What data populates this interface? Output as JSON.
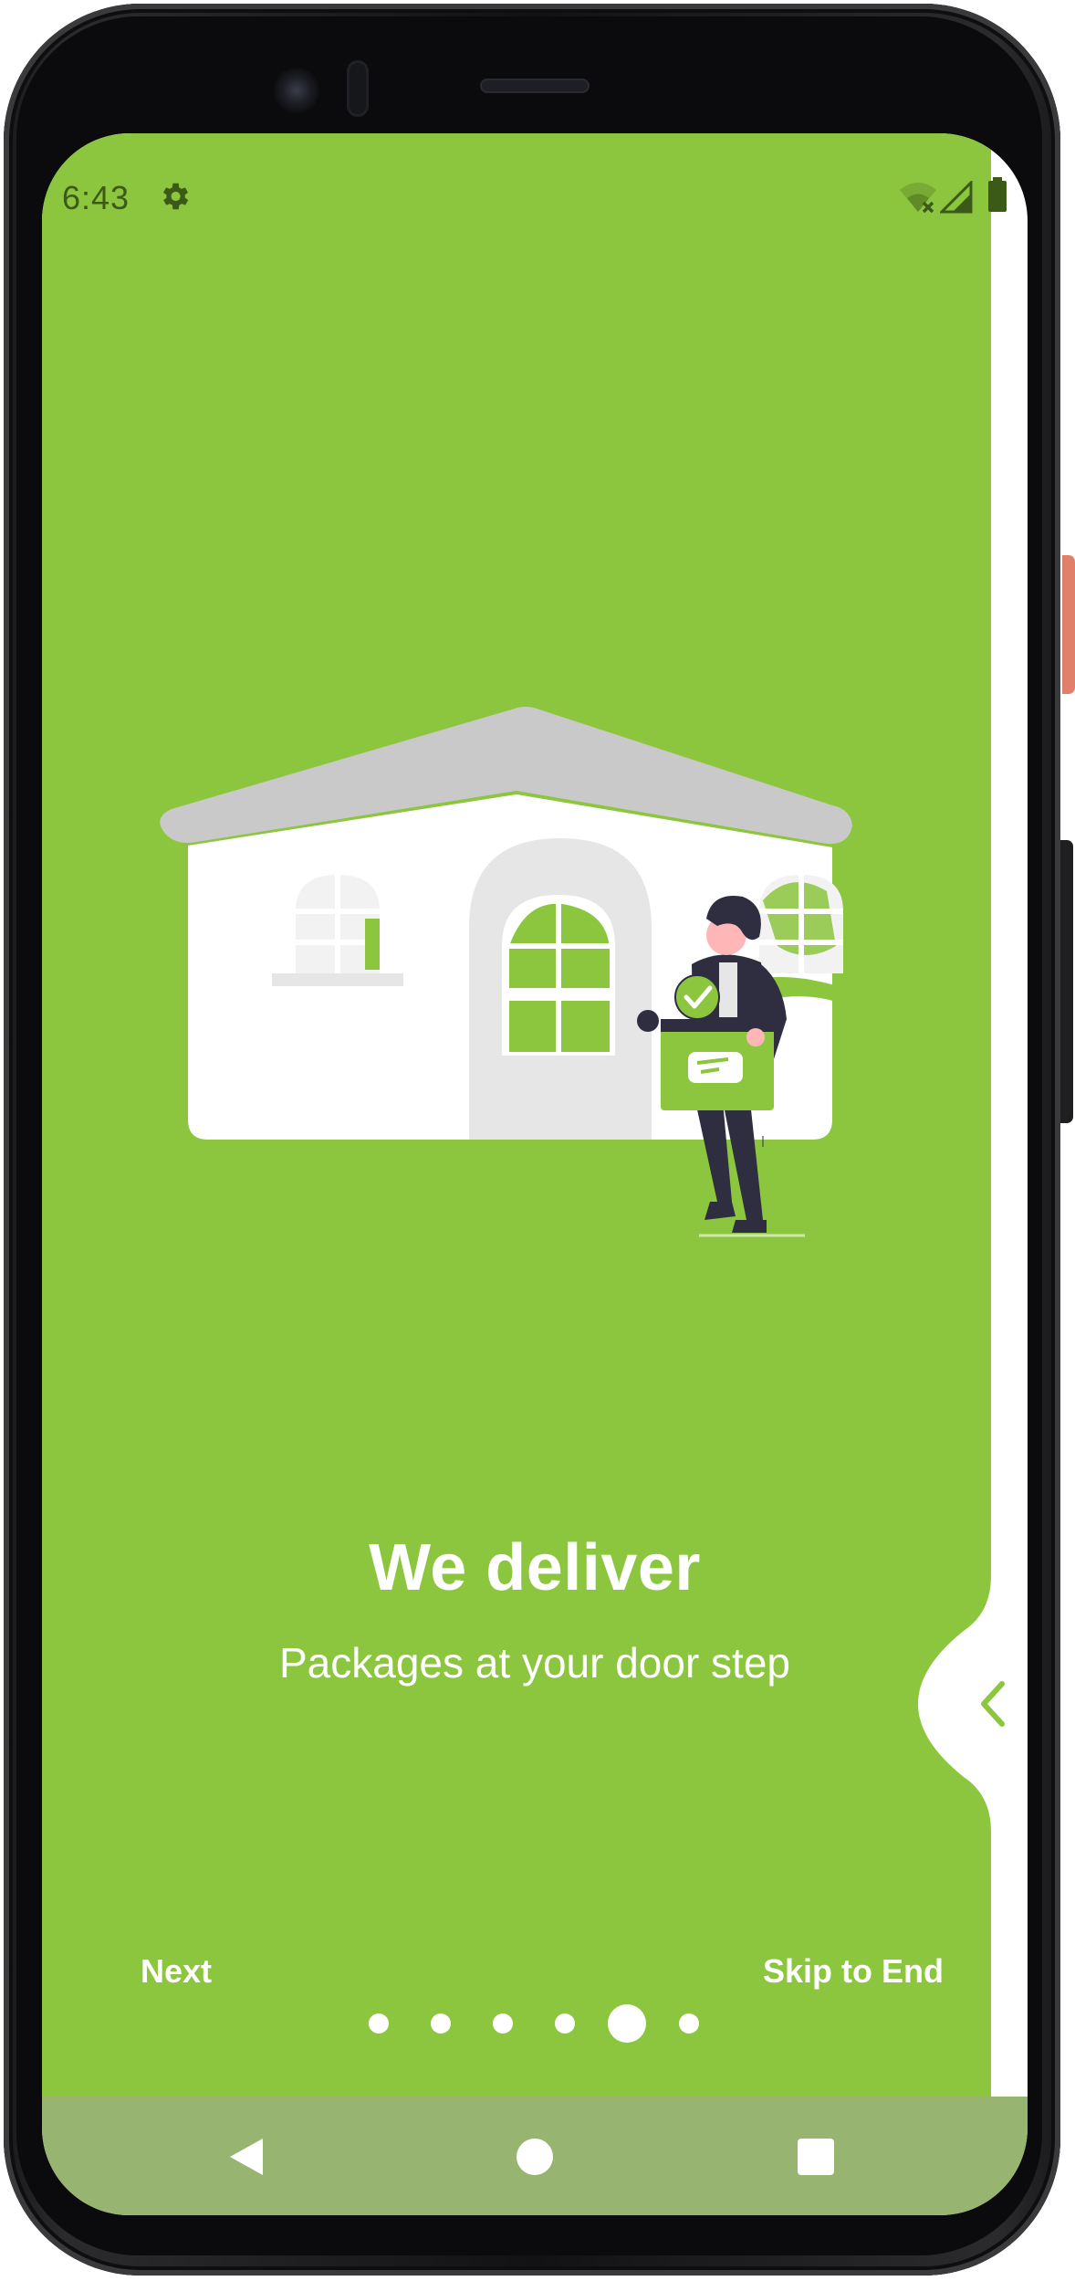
{
  "status_bar": {
    "time": "6:43",
    "settings_icon": "gear-icon",
    "wifi_icon": "wifi-off-icon",
    "signal_icon": "signal-icon",
    "battery_icon": "battery-icon"
  },
  "onboarding": {
    "title": "We deliver",
    "subtitle": "Packages at your door step",
    "illustration": "house-delivery-illustration",
    "next_label": "Next",
    "skip_label": "Skip to End",
    "page_count": 6,
    "current_page": 5,
    "swipe_icon": "chevron-left-icon"
  },
  "nav_bar": {
    "back_icon": "back-triangle-icon",
    "home_icon": "home-circle-icon",
    "recents_icon": "recents-square-icon"
  },
  "colors": {
    "accent_green": "#8cc63f",
    "nav_bar": "#97b570",
    "text": "#ffffff"
  }
}
